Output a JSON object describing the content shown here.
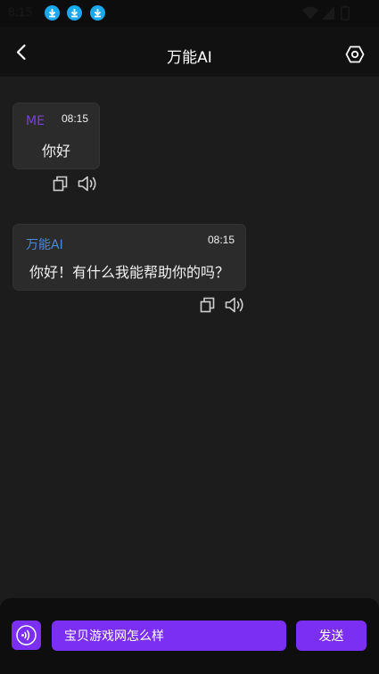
{
  "status_bar": {
    "time": "8:15",
    "notification_icons": [
      "download-icon",
      "download-icon",
      "download-icon"
    ],
    "system_icons": [
      "wifi-icon",
      "signal-icon",
      "battery-icon"
    ]
  },
  "header": {
    "title": "万能AI",
    "back_icon": "chevron-left-icon",
    "settings_icon": "hexagon-settings-icon"
  },
  "messages": [
    {
      "sender": "ME",
      "time": "08:15",
      "text": "你好",
      "sender_color": "#7b3fd8"
    },
    {
      "sender": "万能AI",
      "time": "08:15",
      "text": "你好！有什么我能帮助你的吗？",
      "sender_color": "#4a8bdc"
    }
  ],
  "composer": {
    "voice_icon": "voice-wave-icon",
    "input_value": "宝贝游戏网怎么样",
    "send_label": "发送"
  },
  "colors": {
    "accent": "#7b2ff2",
    "background": "#1c1c1c",
    "header_bg": "#111111",
    "bubble_bg": "#2b2b2b",
    "status_icon": "#1aa8ee"
  }
}
